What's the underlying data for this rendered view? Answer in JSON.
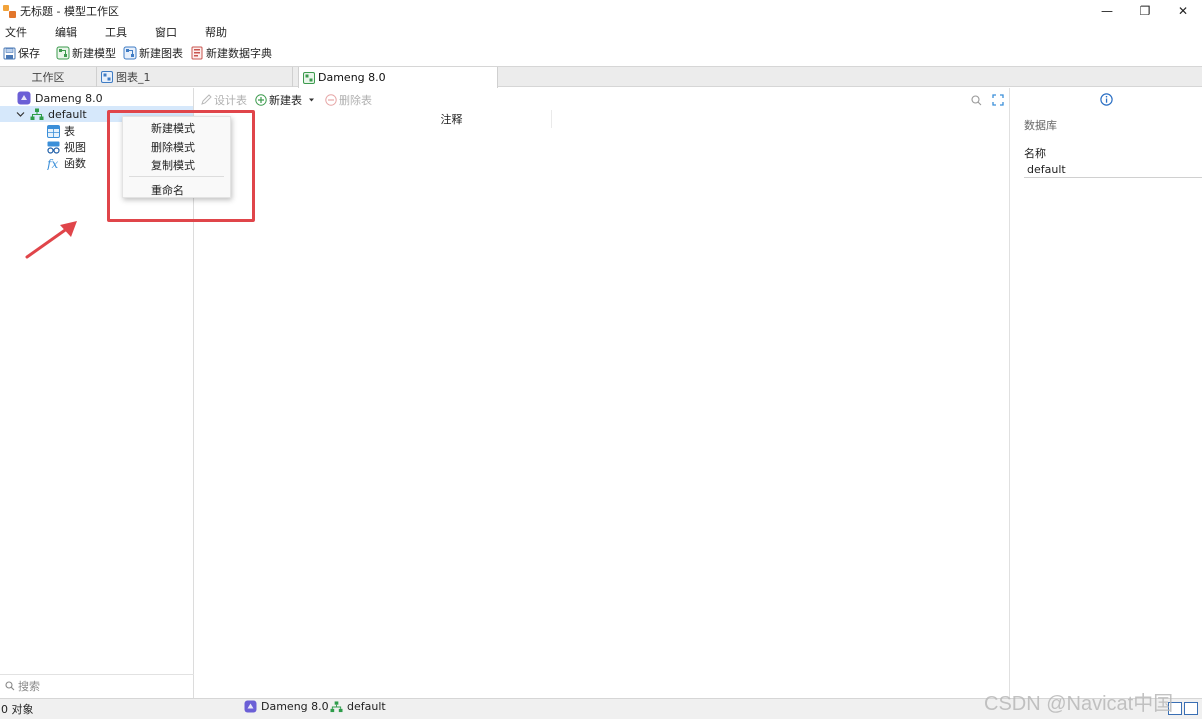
{
  "window": {
    "title": "无标题 - 模型工作区",
    "controls": {
      "minimize": "—",
      "restore": "❐",
      "close": "✕"
    }
  },
  "menu": [
    "文件",
    "编辑",
    "工具",
    "窗口",
    "帮助"
  ],
  "toolbar": {
    "save": "保存",
    "new_model": "新建模型",
    "new_chart": "新建图表",
    "new_dictionary": "新建数据字典"
  },
  "tabs": {
    "workspace": "工作区",
    "chart": "图表_1",
    "database": "Dameng 8.0"
  },
  "tree": {
    "database": "Dameng 8.0",
    "schema": "default",
    "children": [
      "表",
      "视图",
      "函数"
    ]
  },
  "context_menu": {
    "items": [
      "新建模式",
      "删除模式",
      "复制模式"
    ],
    "rename": "重命名"
  },
  "search": {
    "placeholder": "搜索"
  },
  "center": {
    "design_table": "设计表",
    "new_table": "新建表",
    "delete_table": "删除表",
    "column_comment": "注释"
  },
  "properties": {
    "section": "数据库",
    "name_label": "名称",
    "name_value": "default"
  },
  "status": {
    "object_count": "0 对象",
    "database": "Dameng 8.0",
    "schema": "default"
  },
  "watermark": "CSDN @Navicat中国",
  "colors": {
    "annotation_red": "#e0454a",
    "selection": "#d6e8fb",
    "schema_green": "#2e9c4a",
    "db_purple": "#6b5fd6"
  }
}
